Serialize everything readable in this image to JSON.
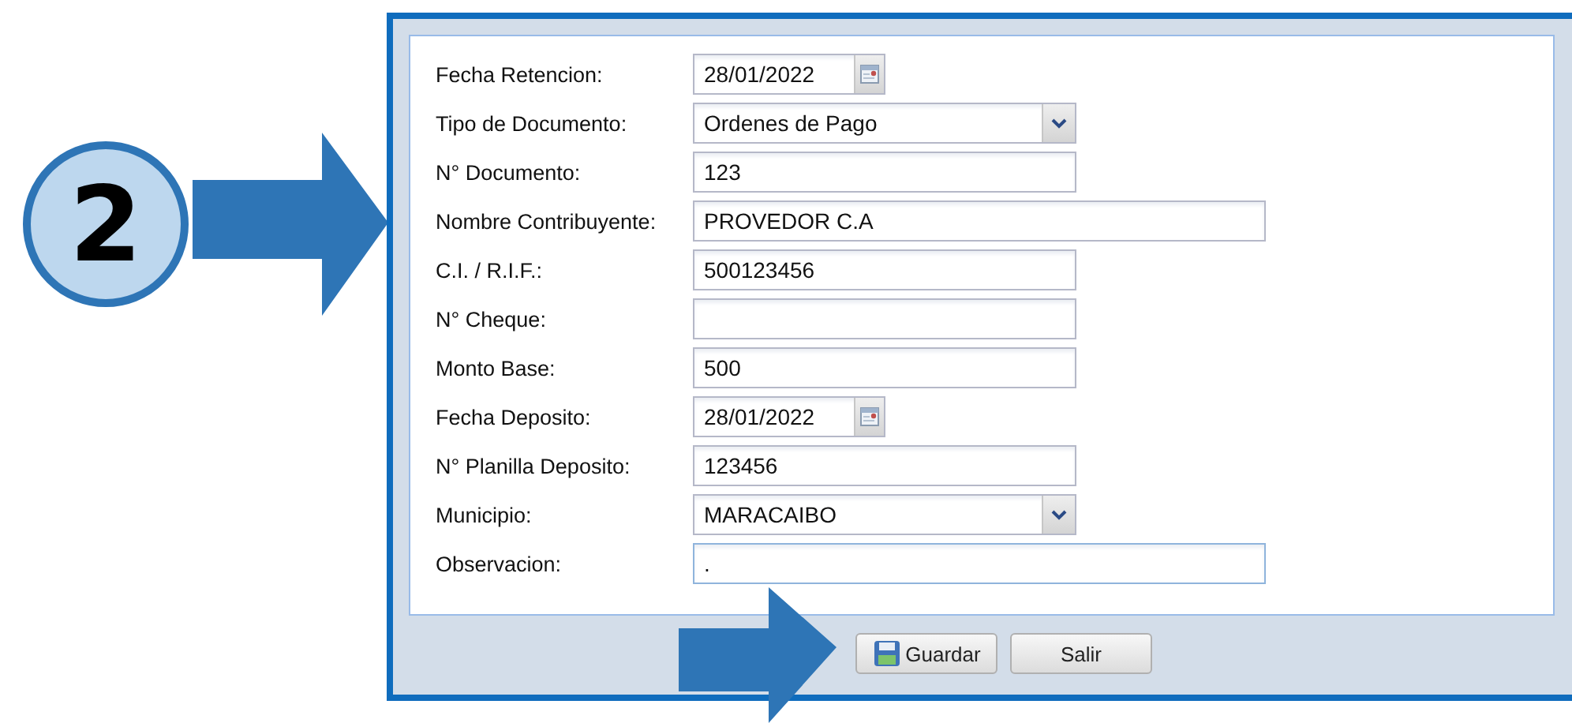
{
  "step": "2",
  "form": {
    "fields": [
      {
        "label": "Fecha Retencion:",
        "kind": "date",
        "value": "28/01/2022",
        "focused": false
      },
      {
        "label": "Tipo de Documento:",
        "kind": "combo",
        "value": "Ordenes de Pago",
        "focused": false
      },
      {
        "label": "N° Documento:",
        "kind": "text",
        "value": "123",
        "focused": false
      },
      {
        "label": "Nombre Contribuyente:",
        "kind": "longtext",
        "value": "PROVEDOR C.A",
        "focused": false
      },
      {
        "label": "C.I. / R.I.F.:",
        "kind": "text",
        "value": "500123456",
        "focused": false
      },
      {
        "label": "N° Cheque:",
        "kind": "text",
        "focused": false
      },
      {
        "label": "Monto Base:",
        "kind": "text",
        "value": "500",
        "focused": false
      },
      {
        "label": "Fecha Deposito:",
        "kind": "date",
        "value": "28/01/2022",
        "focused": false
      },
      {
        "label": "N° Planilla Deposito:",
        "kind": "text",
        "value": "123456",
        "focused": false
      },
      {
        "label": "Municipio:",
        "kind": "combo",
        "value": "MARACAIBO",
        "focused": false
      },
      {
        "label": "Observacion:",
        "kind": "longtext",
        "value": ".",
        "focused": true
      }
    ]
  },
  "buttons": [
    {
      "label": "Guardar",
      "kind": "save"
    },
    {
      "label": "Salir",
      "kind": "exit"
    }
  ]
}
